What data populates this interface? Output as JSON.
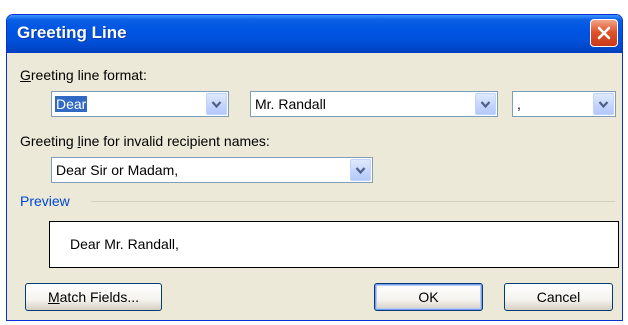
{
  "window": {
    "title": "Greeting Line"
  },
  "greeting_format": {
    "label_accel": "G",
    "label_rest": "reeting line format:",
    "salutation": "Dear",
    "name_format": "Mr. Randall",
    "punctuation": ","
  },
  "invalid_names": {
    "label_pre": "Greeting ",
    "label_accel": "l",
    "label_rest": "ine for invalid recipient names:",
    "value": "Dear Sir or Madam,"
  },
  "preview": {
    "label": "Preview",
    "text": "Dear Mr. Randall,"
  },
  "buttons": {
    "match_fields_accel": "M",
    "match_fields_rest": "atch Fields...",
    "ok": "OK",
    "cancel": "Cancel"
  },
  "colors": {
    "titlebar": "#0054e3",
    "dialog_bg": "#ece9d8",
    "preview_label": "#0046d5",
    "selection": "#316ac5",
    "close_button": "#e0542b"
  }
}
